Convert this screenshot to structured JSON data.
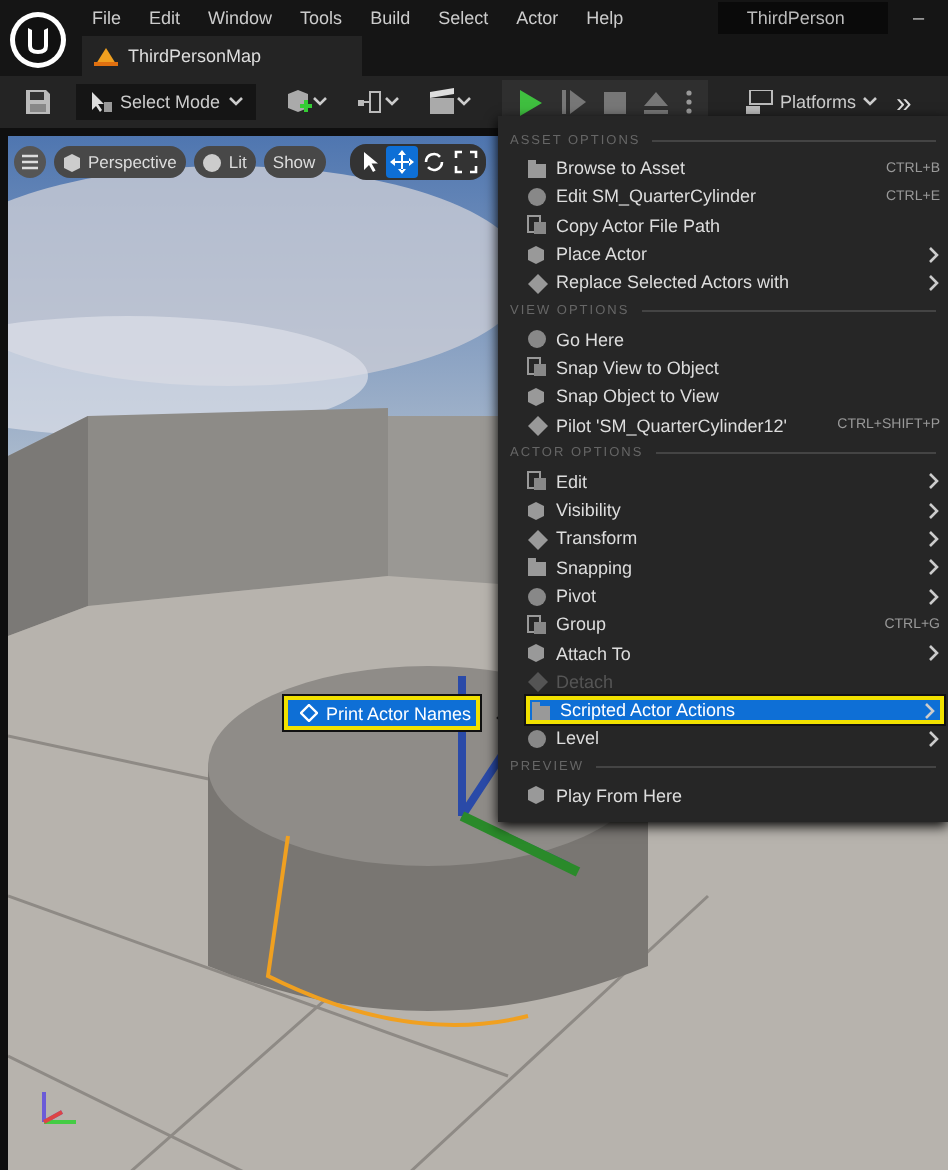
{
  "menu_bar": {
    "items": [
      "File",
      "Edit",
      "Window",
      "Tools",
      "Build",
      "Select",
      "Actor",
      "Help"
    ],
    "project_name": "ThirdPerson",
    "minimize": "–"
  },
  "document_tab": {
    "label": "ThirdPersonMap",
    "selected": true
  },
  "toolbar": {
    "mode_button": "Select Mode",
    "platforms_button": "Platforms",
    "overflow": "»"
  },
  "viewport_toolbar": {
    "buttons": [
      "Perspective",
      "Lit",
      "Show"
    ],
    "transform_tools": [
      {
        "kind": "select",
        "selected": false
      },
      {
        "kind": "move",
        "selected": true
      },
      {
        "kind": "rotate",
        "selected": false
      },
      {
        "kind": "scale",
        "selected": false
      }
    ]
  },
  "context_menu": {
    "sections": [
      {
        "header": "ASSET OPTIONS",
        "items": [
          {
            "label": "Browse to Asset",
            "shortcut": "CTRL+B",
            "submenu": false,
            "selected": false,
            "disabled": false
          },
          {
            "label": "Edit SM_QuarterCylinder",
            "shortcut": "CTRL+E",
            "submenu": false,
            "selected": false,
            "disabled": false
          },
          {
            "label": "Copy Actor File Path",
            "submenu": false,
            "selected": false,
            "disabled": false
          },
          {
            "label": "Place Actor",
            "submenu": true,
            "selected": false,
            "disabled": false
          },
          {
            "label": "Replace Selected Actors with",
            "submenu": true,
            "selected": false,
            "disabled": false
          }
        ]
      },
      {
        "header": "VIEW OPTIONS",
        "items": [
          {
            "label": "Go Here",
            "submenu": false,
            "selected": false,
            "disabled": false
          },
          {
            "label": "Snap View to Object",
            "submenu": false,
            "selected": false,
            "disabled": false
          },
          {
            "label": "Snap Object to View",
            "submenu": false,
            "selected": false,
            "disabled": false
          },
          {
            "label": "Pilot 'SM_QuarterCylinder12'",
            "shortcut": "CTRL+SHIFT+P",
            "submenu": false,
            "selected": false,
            "disabled": false
          }
        ]
      },
      {
        "header": "ACTOR OPTIONS",
        "items": [
          {
            "label": "Edit",
            "submenu": true,
            "selected": false,
            "disabled": false
          },
          {
            "label": "Visibility",
            "submenu": true,
            "selected": false,
            "disabled": false
          },
          {
            "label": "Transform",
            "submenu": true,
            "selected": false,
            "disabled": false
          },
          {
            "label": "Snapping",
            "submenu": true,
            "selected": false,
            "disabled": false
          },
          {
            "label": "Pivot",
            "submenu": true,
            "selected": false,
            "disabled": false
          },
          {
            "label": "Group",
            "shortcut": "CTRL+G",
            "submenu": false,
            "selected": false,
            "disabled": false
          },
          {
            "label": "Attach To",
            "submenu": true,
            "selected": false,
            "disabled": false
          },
          {
            "label": "Detach",
            "submenu": false,
            "selected": false,
            "disabled": true
          },
          {
            "label": "Scripted Actor Actions",
            "submenu": true,
            "selected": true,
            "disabled": false
          },
          {
            "label": "Level",
            "submenu": true,
            "selected": false,
            "disabled": false
          }
        ]
      },
      {
        "header": "PREVIEW",
        "items": [
          {
            "label": "Play From Here",
            "submenu": false,
            "selected": false,
            "disabled": false
          }
        ]
      }
    ]
  },
  "submenu": {
    "label": "Print Actor Names",
    "selected": true
  }
}
